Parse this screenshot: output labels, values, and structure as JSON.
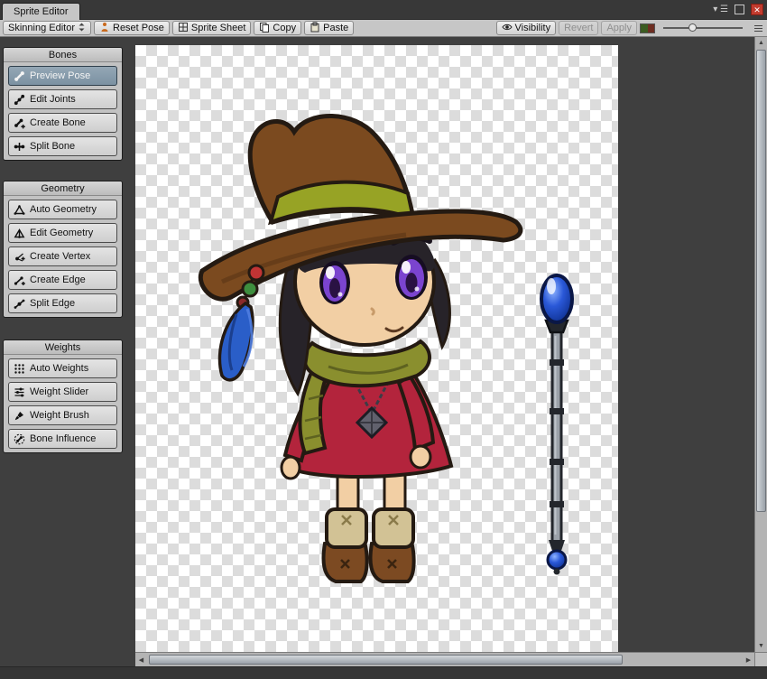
{
  "window": {
    "tab_title": "Sprite Editor"
  },
  "toolbar": {
    "mode_button": "Skinning Editor",
    "reset_pose": "Reset Pose",
    "sprite_sheet": "Sprite Sheet",
    "copy": "Copy",
    "paste": "Paste",
    "visibility": "Visibility",
    "revert": "Revert",
    "apply": "Apply",
    "revert_state": "disabled",
    "apply_state": "disabled",
    "zoom_slider_position": 0.35
  },
  "sidebar": {
    "panels": [
      {
        "title": "Bones",
        "buttons": [
          {
            "label": "Preview Pose",
            "state": "selected"
          },
          {
            "label": "Edit Joints"
          },
          {
            "label": "Create Bone"
          },
          {
            "label": "Split Bone"
          }
        ]
      },
      {
        "title": "Geometry",
        "buttons": [
          {
            "label": "Auto Geometry"
          },
          {
            "label": "Edit Geometry"
          },
          {
            "label": "Create Vertex"
          },
          {
            "label": "Create Edge"
          },
          {
            "label": "Split Edge"
          }
        ]
      },
      {
        "title": "Weights",
        "buttons": [
          {
            "label": "Auto Weights"
          },
          {
            "label": "Weight Slider"
          },
          {
            "label": "Weight Brush"
          },
          {
            "label": "Bone Influence"
          }
        ]
      }
    ]
  },
  "canvas": {
    "sprite_description": "Chibi witch character: brown floppy hat with olive band, black hair, large purple eyes, olive scarf, red dress with cube pendant, tan boot cuffs, brown boots; separate staff with blue orbs",
    "checker_light": "#ffffff",
    "checker_dark": "#dcdcdc",
    "background": "#3f3f3f"
  },
  "colors": {
    "selection": "#7b91a2",
    "toolbar_bg": "#c6c6c6",
    "chrome_bg": "#383838",
    "close_button": "#c23b2e"
  }
}
